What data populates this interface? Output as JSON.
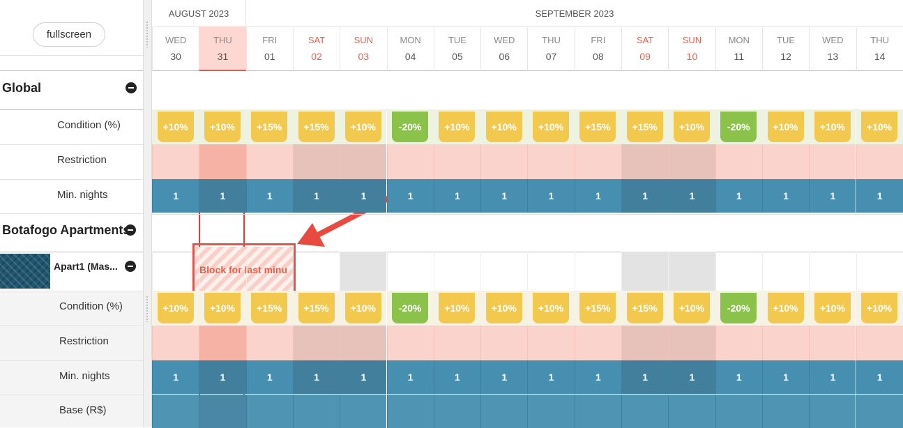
{
  "toolbar": {
    "fullscreen_label": "fullscreen"
  },
  "months": [
    "AUGUST 2023",
    "SEPTEMBER 2023"
  ],
  "days": [
    {
      "dow": "WED",
      "num": "30"
    },
    {
      "dow": "THU",
      "num": "31"
    },
    {
      "dow": "FRI",
      "num": "01"
    },
    {
      "dow": "SAT",
      "num": "02"
    },
    {
      "dow": "SUN",
      "num": "03"
    },
    {
      "dow": "MON",
      "num": "04"
    },
    {
      "dow": "TUE",
      "num": "05"
    },
    {
      "dow": "WED",
      "num": "06"
    },
    {
      "dow": "THU",
      "num": "07"
    },
    {
      "dow": "FRI",
      "num": "08"
    },
    {
      "dow": "SAT",
      "num": "09"
    },
    {
      "dow": "SUN",
      "num": "10"
    },
    {
      "dow": "MON",
      "num": "11"
    },
    {
      "dow": "TUE",
      "num": "12"
    },
    {
      "dow": "WED",
      "num": "13"
    },
    {
      "dow": "THU",
      "num": "14"
    }
  ],
  "global": {
    "title": "Global",
    "rows": {
      "condition": "Condition (%)",
      "restriction": "Restriction",
      "min_nights": "Min. nights"
    }
  },
  "property": {
    "title": "Botafogo Apartments",
    "unit_name": "Apart1 (Mas...",
    "rows": {
      "condition": "Condition (%)",
      "restriction": "Restriction",
      "min_nights": "Min. nights",
      "base": "Base (R$)"
    }
  },
  "conditions": [
    "+10%",
    "+10%",
    "+15%",
    "+15%",
    "+10%",
    "-20%",
    "+10%",
    "+10%",
    "+10%",
    "+15%",
    "+15%",
    "+10%",
    "-20%",
    "+10%",
    "+10%",
    "+10%"
  ],
  "min_nights": [
    "1",
    "1",
    "1",
    "1",
    "1",
    "1",
    "1",
    "1",
    "1",
    "1",
    "1",
    "1",
    "1",
    "1",
    "1",
    "1"
  ],
  "block": {
    "label": "Block for last minu"
  },
  "colors": {
    "accent_red": "#e53935",
    "weekend_text": "#e8604c",
    "condition_pos": "#f2c94c",
    "condition_neg": "#8bc34a",
    "min_nights_bg": "#468fb0"
  }
}
